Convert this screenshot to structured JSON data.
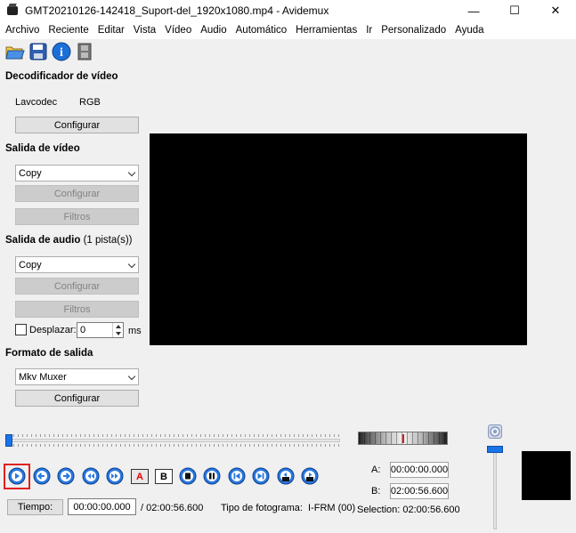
{
  "window": {
    "title": "GMT20210126-142418_Suport-del_1920x1080.mp4 - Avidemux",
    "minimize": "—",
    "maximize": "☐",
    "close": "✕"
  },
  "menu": [
    "Archivo",
    "Reciente",
    "Editar",
    "Vista",
    "Vídeo",
    "Audio",
    "Automático",
    "Herramientas",
    "Ir",
    "Personalizado",
    "Ayuda"
  ],
  "toolbar": [
    "open-file-icon",
    "save-icon",
    "info-icon",
    "film-icon"
  ],
  "video_decoder": {
    "heading": "Decodificador de vídeo",
    "codec": "Lavcodec",
    "format": "RGB",
    "configure": "Configurar"
  },
  "video_output": {
    "heading": "Salida de vídeo",
    "codec": "Copy",
    "configure": "Configurar",
    "filters": "Filtros"
  },
  "audio_output": {
    "heading": "Salida de audio",
    "tracks": "(1 pista(s))",
    "codec": "Copy",
    "configure": "Configurar",
    "filters": "Filtros",
    "shift_label": "Desplazar:",
    "shift_value": "0",
    "shift_unit": "ms"
  },
  "output_format": {
    "heading": "Formato de salida",
    "muxer": "Mkv Muxer",
    "configure": "Configurar"
  },
  "markers": {
    "a_label": "A:",
    "a_value": "00:00:00.000",
    "b_label": "B:",
    "b_value": "02:00:56.600",
    "selection": "Selection: 02:00:56.600"
  },
  "transport": {
    "marker_a": "A",
    "marker_b": "B"
  },
  "status": {
    "time_button": "Tiempo:",
    "current_time": "00:00:00.000",
    "total_time": "/ 02:00:56.600",
    "frame_type": "Tipo de fotograma:  I-FRM (00)"
  },
  "colors": {
    "accent": "#1a73e8",
    "highlight": "#e02020"
  }
}
